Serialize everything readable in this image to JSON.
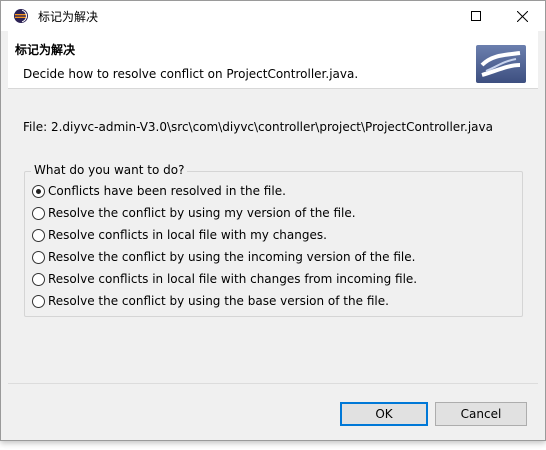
{
  "window": {
    "title": "标记为解决",
    "icon": "eclipse-app-icon"
  },
  "banner": {
    "title": "标记为解决",
    "description": "Decide how to resolve conflict on ProjectController.java.",
    "logo": "svn-merge-logo-icon"
  },
  "file_label": "File: 2.diyvc-admin-V3.0\\src\\com\\diyvc\\controller\\project\\ProjectController.java",
  "options": {
    "legend": "What do you want to do?",
    "items": [
      {
        "label": "Conflicts have been resolved in the file.",
        "checked": true
      },
      {
        "label": "Resolve the conflict by using my version of the file.",
        "checked": false
      },
      {
        "label": "Resolve conflicts in local file with my changes.",
        "checked": false
      },
      {
        "label": "Resolve the conflict by using the incoming version of the file.",
        "checked": false
      },
      {
        "label": "Resolve conflicts in local file with changes from incoming file.",
        "checked": false
      },
      {
        "label": "Resolve the conflict by using the base version of the file.",
        "checked": false
      }
    ]
  },
  "buttons": {
    "ok": "OK",
    "cancel": "Cancel"
  },
  "colors": {
    "accent": "#0078d7",
    "dialog_bg": "#f0f0f0"
  }
}
